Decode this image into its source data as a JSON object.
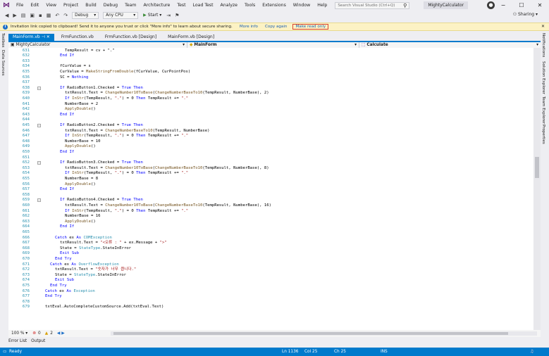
{
  "titlebar": {
    "menu": [
      "File",
      "Edit",
      "View",
      "Project",
      "Build",
      "Debug",
      "Team",
      "Architecture",
      "Test",
      "Load Test",
      "Analyze",
      "Tools",
      "Extensions",
      "Window",
      "Help"
    ],
    "search_placeholder": "Search Visual Studio (Ctrl+Q)",
    "solution_name": "MightyCalculator",
    "logo_icon": "visual-studio-logo-icon",
    "controls": [
      "−",
      "☐",
      "✕"
    ]
  },
  "toolbar": {
    "config": "Debug",
    "platform": "Any CPU",
    "start_label": "Start",
    "sharing_label": "Sharing"
  },
  "infobar": {
    "message": "Invitation link copied to clipboard! Send it to anyone you trust or click \"More info\" to learn about secure sharing.",
    "more_info": "More info",
    "copy_again": "Copy again",
    "make_read_only": "Make read only"
  },
  "left_rail": [
    "Toolbox",
    "Data Sources"
  ],
  "right_rail": [
    "Notifications",
    "Solution Explorer",
    "Team Explorer",
    "Properties"
  ],
  "tabs": [
    {
      "label": "MainForm.vb",
      "active": true
    },
    {
      "label": "FrmFunction.vb",
      "active": false
    },
    {
      "label": "FrmFunction.vb [Design]",
      "active": false
    },
    {
      "label": "MainForm.vb [Design]",
      "active": false
    }
  ],
  "navbar": {
    "project": "MightyCalculator",
    "class": "MainForm",
    "member": "Calculate"
  },
  "code_lines": [
    {
      "n": "631",
      "indent": 8,
      "tokens": [
        [
          "plain",
          "TempResult = cv + \".\""
        ]
      ]
    },
    {
      "n": "632",
      "indent": 6,
      "tokens": [
        [
          "kw",
          "End If"
        ]
      ]
    },
    {
      "n": "633",
      "indent": 0,
      "tokens": []
    },
    {
      "n": "634",
      "indent": 6,
      "tokens": [
        [
          "plain",
          "fCurValue = s"
        ]
      ]
    },
    {
      "n": "635",
      "indent": 6,
      "tokens": [
        [
          "plain",
          "CurValue = "
        ],
        [
          "fn",
          "MakeStringFromDouble"
        ],
        [
          "plain",
          "(fCurValue, CurPointPos)"
        ]
      ]
    },
    {
      "n": "636",
      "indent": 6,
      "tokens": [
        [
          "plain",
          "SC = "
        ],
        [
          "kw",
          "Nothing"
        ]
      ]
    },
    {
      "n": "637",
      "indent": 0,
      "tokens": []
    },
    {
      "n": "638",
      "indent": 6,
      "fold": true,
      "tokens": [
        [
          "kw",
          "If "
        ],
        [
          "plain",
          "RadioButton1.Checked = "
        ],
        [
          "kw",
          "True Then"
        ]
      ]
    },
    {
      "n": "639",
      "indent": 8,
      "tokens": [
        [
          "plain",
          "txtResult.Text = "
        ],
        [
          "fn",
          "ChangeNumber10ToBase"
        ],
        [
          "plain",
          "("
        ],
        [
          "fn",
          "ChangeNumberBaseTo10"
        ],
        [
          "plain",
          "(TempResult, NumberBase), 2)"
        ]
      ]
    },
    {
      "n": "640",
      "indent": 8,
      "tokens": [
        [
          "kw",
          "If "
        ],
        [
          "fn",
          "InStr"
        ],
        [
          "plain",
          "(TempResult, "
        ],
        [
          "str",
          "\".\""
        ],
        [
          "plain",
          ") = 0 "
        ],
        [
          "kw",
          "Then "
        ],
        [
          "plain",
          "TempResult += "
        ],
        [
          "str",
          "\".\""
        ]
      ]
    },
    {
      "n": "641",
      "indent": 8,
      "tokens": [
        [
          "plain",
          "NumberBase = 2"
        ]
      ]
    },
    {
      "n": "642",
      "indent": 8,
      "tokens": [
        [
          "fn",
          "ApplyDouble"
        ],
        [
          "plain",
          "()"
        ]
      ]
    },
    {
      "n": "643",
      "indent": 6,
      "tokens": [
        [
          "kw",
          "End If"
        ]
      ]
    },
    {
      "n": "644",
      "indent": 0,
      "tokens": []
    },
    {
      "n": "645",
      "indent": 6,
      "fold": true,
      "tokens": [
        [
          "kw",
          "If "
        ],
        [
          "plain",
          "RadioButton2.Checked = "
        ],
        [
          "kw",
          "True Then"
        ]
      ]
    },
    {
      "n": "646",
      "indent": 8,
      "tokens": [
        [
          "plain",
          "txtResult.Text = "
        ],
        [
          "fn",
          "ChangeNumberBaseTo10"
        ],
        [
          "plain",
          "(TempResult, NumberBase)"
        ]
      ]
    },
    {
      "n": "647",
      "indent": 8,
      "tokens": [
        [
          "kw",
          "If "
        ],
        [
          "fn",
          "InStr"
        ],
        [
          "plain",
          "(TempResult, "
        ],
        [
          "str",
          "\".\""
        ],
        [
          "plain",
          ") = 0 "
        ],
        [
          "kw",
          "Then "
        ],
        [
          "plain",
          "TempResult += "
        ],
        [
          "str",
          "\".\""
        ]
      ]
    },
    {
      "n": "648",
      "indent": 8,
      "tokens": [
        [
          "plain",
          "NumberBase = 10"
        ]
      ]
    },
    {
      "n": "649",
      "indent": 8,
      "tokens": [
        [
          "fn",
          "ApplyDouble"
        ],
        [
          "plain",
          "()"
        ]
      ]
    },
    {
      "n": "650",
      "indent": 6,
      "tokens": [
        [
          "kw",
          "End If"
        ]
      ]
    },
    {
      "n": "651",
      "indent": 0,
      "tokens": []
    },
    {
      "n": "652",
      "indent": 6,
      "fold": true,
      "tokens": [
        [
          "kw",
          "If "
        ],
        [
          "plain",
          "RadioButton3.Checked = "
        ],
        [
          "kw",
          "True Then"
        ]
      ]
    },
    {
      "n": "653",
      "indent": 8,
      "tokens": [
        [
          "plain",
          "txtResult.Text = "
        ],
        [
          "fn",
          "ChangeNumber10ToBase"
        ],
        [
          "plain",
          "("
        ],
        [
          "fn",
          "ChangeNumberBaseTo10"
        ],
        [
          "plain",
          "(TempResult, NumberBase), 8)"
        ]
      ]
    },
    {
      "n": "654",
      "indent": 8,
      "tokens": [
        [
          "kw",
          "If "
        ],
        [
          "fn",
          "InStr"
        ],
        [
          "plain",
          "(TempResult, "
        ],
        [
          "str",
          "\".\""
        ],
        [
          "plain",
          ") = 0 "
        ],
        [
          "kw",
          "Then "
        ],
        [
          "plain",
          "TempResult += "
        ],
        [
          "str",
          "\".\""
        ]
      ]
    },
    {
      "n": "655",
      "indent": 8,
      "tokens": [
        [
          "plain",
          "NumberBase = 8"
        ]
      ]
    },
    {
      "n": "656",
      "indent": 8,
      "tokens": [
        [
          "fn",
          "ApplyDouble"
        ],
        [
          "plain",
          "()"
        ]
      ]
    },
    {
      "n": "657",
      "indent": 6,
      "tokens": [
        [
          "kw",
          "End If"
        ]
      ]
    },
    {
      "n": "658",
      "indent": 0,
      "tokens": []
    },
    {
      "n": "659",
      "indent": 6,
      "fold": true,
      "tokens": [
        [
          "kw",
          "If "
        ],
        [
          "plain",
          "RadioButton4.Checked = "
        ],
        [
          "kw",
          "True Then"
        ]
      ]
    },
    {
      "n": "660",
      "indent": 8,
      "tokens": [
        [
          "plain",
          "txtResult.Text = "
        ],
        [
          "fn",
          "ChangeNumber10ToBase"
        ],
        [
          "plain",
          "("
        ],
        [
          "fn",
          "ChangeNumberBaseTo10"
        ],
        [
          "plain",
          "(TempResult, NumberBase), 16)"
        ]
      ]
    },
    {
      "n": "661",
      "indent": 8,
      "tokens": [
        [
          "kw",
          "If "
        ],
        [
          "fn",
          "InStr"
        ],
        [
          "plain",
          "(TempResult, "
        ],
        [
          "str",
          "\".\""
        ],
        [
          "plain",
          ") = 0 "
        ],
        [
          "kw",
          "Then "
        ],
        [
          "plain",
          "TempResult += "
        ],
        [
          "str",
          "\".\""
        ]
      ]
    },
    {
      "n": "662",
      "indent": 8,
      "tokens": [
        [
          "plain",
          "NumberBase = 16"
        ]
      ]
    },
    {
      "n": "663",
      "indent": 8,
      "tokens": [
        [
          "fn",
          "ApplyDouble"
        ],
        [
          "plain",
          "()"
        ]
      ]
    },
    {
      "n": "664",
      "indent": 6,
      "tokens": [
        [
          "kw",
          "End If"
        ]
      ]
    },
    {
      "n": "665",
      "indent": 0,
      "tokens": []
    },
    {
      "n": "666",
      "indent": 4,
      "tokens": [
        [
          "kw",
          "Catch "
        ],
        [
          "plain",
          "ex "
        ],
        [
          "kw",
          "As "
        ],
        [
          "typ",
          "COMException"
        ]
      ]
    },
    {
      "n": "667",
      "indent": 6,
      "tokens": [
        [
          "plain",
          "txtResult.Text = "
        ],
        [
          "str",
          "\"<오류 : \""
        ],
        [
          "plain",
          " + ex.Message + "
        ],
        [
          "str",
          "\">\""
        ]
      ]
    },
    {
      "n": "668",
      "indent": 6,
      "tokens": [
        [
          "plain",
          "State = "
        ],
        [
          "typ",
          "StateType"
        ],
        [
          "plain",
          ".StateInError"
        ]
      ]
    },
    {
      "n": "669",
      "indent": 6,
      "tokens": [
        [
          "kw",
          "Exit Sub"
        ]
      ]
    },
    {
      "n": "670",
      "indent": 4,
      "tokens": [
        [
          "kw",
          "End Try"
        ]
      ]
    },
    {
      "n": "671",
      "indent": 2,
      "tokens": [
        [
          "kw",
          "Catch "
        ],
        [
          "plain",
          "ex "
        ],
        [
          "kw",
          "As "
        ],
        [
          "typ",
          "OverflowException"
        ]
      ]
    },
    {
      "n": "672",
      "indent": 4,
      "tokens": [
        [
          "plain",
          "txtResult.Text = "
        ],
        [
          "str",
          "\"숫자가 너무 큽니다.\""
        ]
      ]
    },
    {
      "n": "673",
      "indent": 4,
      "tokens": [
        [
          "plain",
          "State = "
        ],
        [
          "typ",
          "StateType"
        ],
        [
          "plain",
          ".StateInError"
        ]
      ]
    },
    {
      "n": "674",
      "indent": 4,
      "tokens": [
        [
          "kw",
          "Exit Sub"
        ]
      ]
    },
    {
      "n": "675",
      "indent": 2,
      "tokens": [
        [
          "kw",
          "End Try"
        ]
      ]
    },
    {
      "n": "676",
      "indent": 0,
      "tokens": [
        [
          "kw",
          "Catch "
        ],
        [
          "plain",
          "ex "
        ],
        [
          "kw",
          "As "
        ],
        [
          "typ",
          "Exception"
        ]
      ]
    },
    {
      "n": "677",
      "indent": 0,
      "tokens": [
        [
          "kw",
          "End Try"
        ]
      ]
    },
    {
      "n": "678",
      "indent": 0,
      "tokens": []
    },
    {
      "n": "679",
      "indent": 0,
      "tokens": [
        [
          "plain",
          "txtEval.AutoCompleteCustomSource.Add(txtEval.Text)"
        ]
      ]
    }
  ],
  "editor_status": {
    "zoom": "100 %",
    "errors": "0",
    "warnings": "2"
  },
  "bottom_tabs": [
    "Error List",
    "Output"
  ],
  "statusbar": {
    "ready": "Ready",
    "ln": "Ln 1136",
    "col": "Col 25",
    "ch": "Ch 25",
    "mode": "INS"
  },
  "colors": {
    "accent": "#007acc",
    "keyword": "#0000ff",
    "string": "#a31515",
    "type": "#2b91af",
    "function": "#74531f"
  }
}
